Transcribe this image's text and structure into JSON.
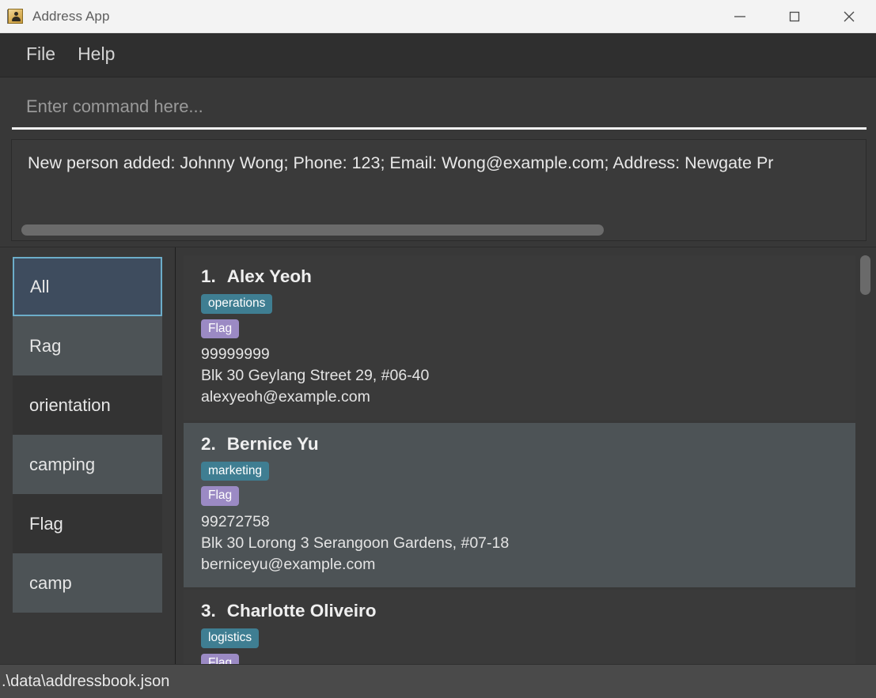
{
  "window": {
    "title": "Address App",
    "icon": "address-book-icon",
    "controls": {
      "minimize": "minimize-icon",
      "maximize": "maximize-icon",
      "close": "close-icon"
    }
  },
  "menubar": {
    "items": [
      {
        "label": "File"
      },
      {
        "label": "Help"
      }
    ]
  },
  "command": {
    "value": "",
    "placeholder": "Enter command here..."
  },
  "result": {
    "text": "New person added: Johnny Wong; Phone: 123; Email: Wong@example.com; Address: Newgate Pr",
    "scroll": "horizontal-scrollbar"
  },
  "sidebar": {
    "items": [
      {
        "label": "All",
        "selected": true
      },
      {
        "label": "Rag",
        "selected": false
      },
      {
        "label": "orientation",
        "selected": false
      },
      {
        "label": "camping",
        "selected": false
      },
      {
        "label": "Flag",
        "selected": false
      },
      {
        "label": "camp",
        "selected": false
      }
    ]
  },
  "persons": [
    {
      "index": "1.",
      "name": "Alex Yeoh",
      "category": "operations",
      "flag": "Flag",
      "phone": "99999999",
      "address": "Blk 30 Geylang Street 29, #06-40",
      "email": "alexyeoh@example.com"
    },
    {
      "index": "2.",
      "name": "Bernice Yu",
      "category": "marketing",
      "flag": "Flag",
      "phone": "99272758",
      "address": "Blk 30 Lorong 3 Serangoon Gardens, #07-18",
      "email": "berniceyu@example.com"
    },
    {
      "index": "3.",
      "name": "Charlotte Oliveiro",
      "category": "logistics",
      "flag": "Flag",
      "phone": "",
      "address": "",
      "email": ""
    }
  ],
  "statusbar": {
    "path": ".\\data\\addressbook.json"
  },
  "colors": {
    "accent_tag": "#3f7e92",
    "flag_tag": "#9b8ac4",
    "selection_border": "#6cadc9",
    "selection_fill": "#3e4c5e",
    "window_bg": "#383838",
    "card_bg": "#3a3a3a",
    "card_alt_bg": "#4d5356",
    "statusbar_bg": "#4a4a4a"
  }
}
